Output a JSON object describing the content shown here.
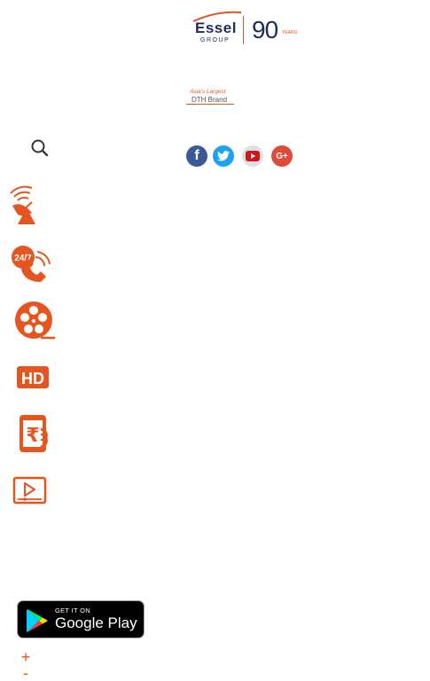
{
  "header": {
    "essel_logo": {
      "word": "Essel",
      "group": "GROUP",
      "ninety": "90",
      "years": "YEARS"
    },
    "dth_logo": {
      "line1": "Asia's Largest",
      "line2": "DTH Brand"
    }
  },
  "social": [
    {
      "name": "facebook",
      "glyph": "f",
      "color": "#3b5998"
    },
    {
      "name": "twitter",
      "color": "#1da1f2"
    },
    {
      "name": "youtube",
      "color": "#e1e1e1"
    },
    {
      "name": "google-plus",
      "glyph": "G+",
      "color": "#dd4b39"
    }
  ],
  "search": {
    "icon": "search-icon"
  },
  "features": [
    {
      "name": "satellite-dish-icon"
    },
    {
      "name": "support-24-7-icon",
      "label": "24/7"
    },
    {
      "name": "film-reel-icon"
    },
    {
      "name": "hd-icon",
      "label": "HD"
    },
    {
      "name": "mobile-recharge-icon",
      "label": "₹"
    },
    {
      "name": "video-play-icon"
    }
  ],
  "app_badge": {
    "get_it_on": "GET IT ON",
    "store": "Google Play"
  },
  "zoom": {
    "in_label": "+",
    "out_label": "-"
  },
  "colors": {
    "brand_orange": "#e5551f",
    "brand_navy": "#1e2d5c"
  }
}
